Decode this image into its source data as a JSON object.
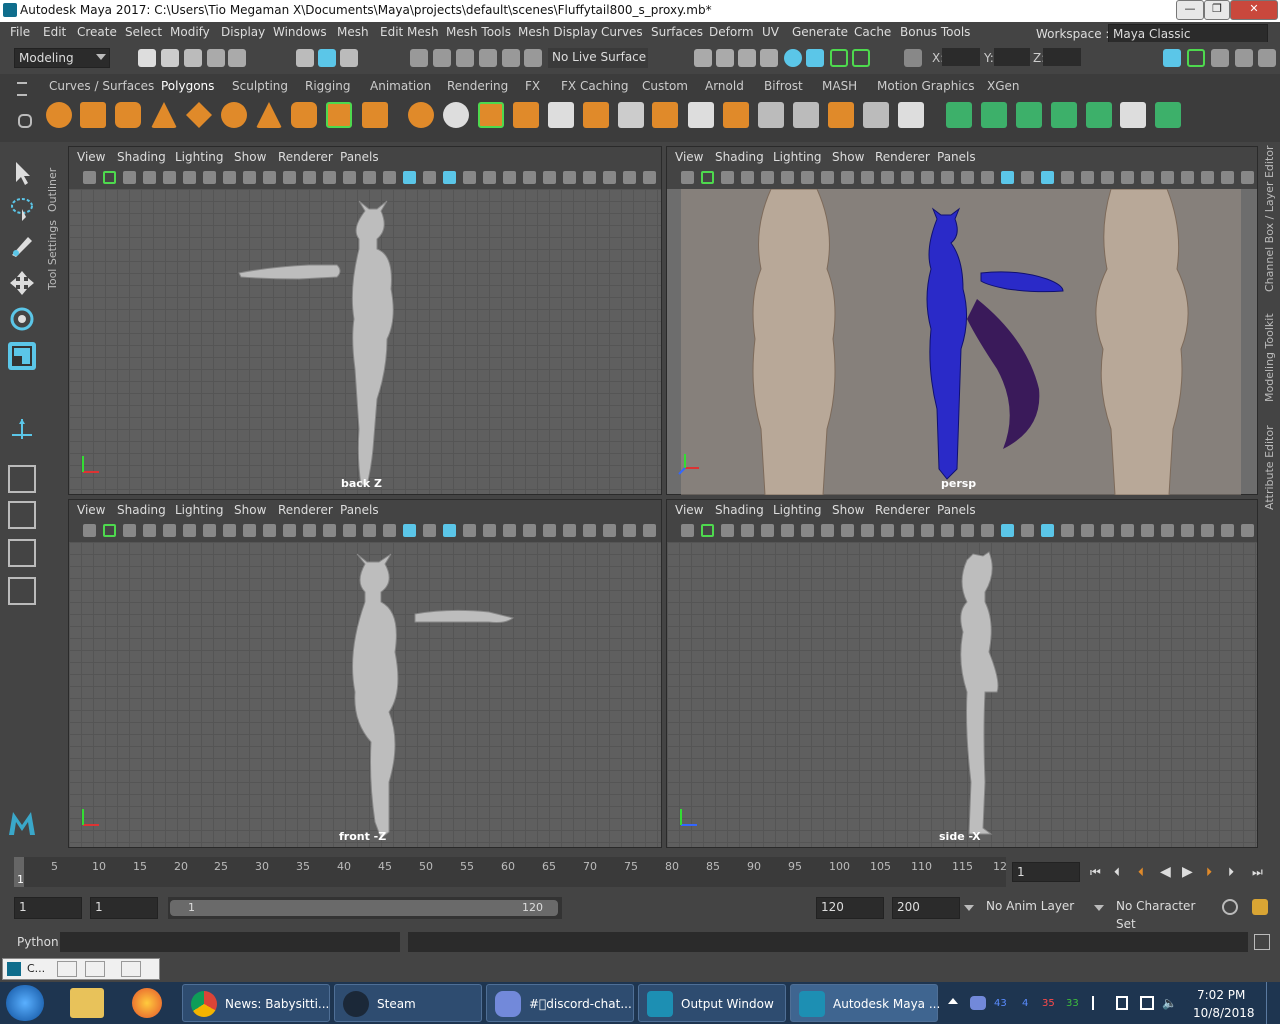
{
  "window": {
    "title": "Autodesk Maya 2017: C:\\Users\\Tio Megaman X\\Documents\\Maya\\projects\\default\\scenes\\Fluffytail800_s_proxy.mb*",
    "minimize": "—",
    "restore": "❐",
    "close": "✕"
  },
  "menubar": [
    "File",
    "Edit",
    "Create",
    "Select",
    "Modify",
    "Display",
    "Windows",
    "Mesh",
    "Edit Mesh",
    "Mesh Tools",
    "Mesh Display",
    "Curves",
    "Surfaces",
    "Deform",
    "UV",
    "Generate",
    "Cache",
    "Bonus Tools"
  ],
  "workspace": {
    "label": "Workspace :",
    "value": "Maya Classic"
  },
  "statusline": {
    "mode": "Modeling",
    "live_surface": "No Live Surface",
    "x_label": "X:",
    "y_label": "Y:",
    "z_label": "Z:"
  },
  "shelf_tabs": [
    "Curves / Surfaces",
    "Polygons",
    "Sculpting",
    "Rigging",
    "Animation",
    "Rendering",
    "FX",
    "FX Caching",
    "Custom",
    "Arnold",
    "Bifrost",
    "MASH",
    "Motion Graphics",
    "XGen"
  ],
  "shelf_active": "Polygons",
  "side_tabs": {
    "outliner": "Outliner",
    "tool_settings": "Tool Settings"
  },
  "right_tabs": {
    "channel_box": "Channel Box / Layer Editor",
    "modeling_toolkit": "Modeling Toolkit",
    "attribute_editor": "Attribute Editor"
  },
  "viewport_menu": [
    "View",
    "Shading",
    "Lighting",
    "Show",
    "Renderer",
    "Panels"
  ],
  "viewports": [
    {
      "label": "back Z"
    },
    {
      "label": "persp"
    },
    {
      "label": "front -Z"
    },
    {
      "label": "side -X"
    }
  ],
  "axis_labels": {
    "x": "x",
    "y": "y",
    "z": "z"
  },
  "timeline": {
    "ticks": [
      "5",
      "10",
      "15",
      "20",
      "25",
      "30",
      "35",
      "40",
      "45",
      "50",
      "55",
      "60",
      "65",
      "70",
      "75",
      "80",
      "85",
      "90",
      "95",
      "100",
      "105",
      "110",
      "115",
      "12"
    ],
    "start_marker": "1",
    "current_frame": "1"
  },
  "range": {
    "start": "1",
    "playback_start": "1",
    "slider_start": "1",
    "slider_end": "120",
    "playback_end": "120",
    "end": "200",
    "anim_layer": "No Anim Layer",
    "char_set": "No Character Set"
  },
  "cmdline": {
    "label": "Python"
  },
  "minibar": {
    "label": "C..."
  },
  "taskbar": {
    "items": [
      {
        "label": "News: Babysitti..."
      },
      {
        "label": "Steam"
      },
      {
        "label": "#\u0000discord-chat..."
      },
      {
        "label": "Output Window"
      },
      {
        "label": "Autodesk Maya ..."
      }
    ],
    "time": "7:02 PM",
    "date": "10/8/2018",
    "tray_numbers": [
      "43",
      "4",
      "35",
      "33"
    ]
  },
  "colors": {
    "accent_green": "#4ed94e",
    "maya_blue": "#5bc6e8",
    "taskbar": "#1e3550"
  }
}
